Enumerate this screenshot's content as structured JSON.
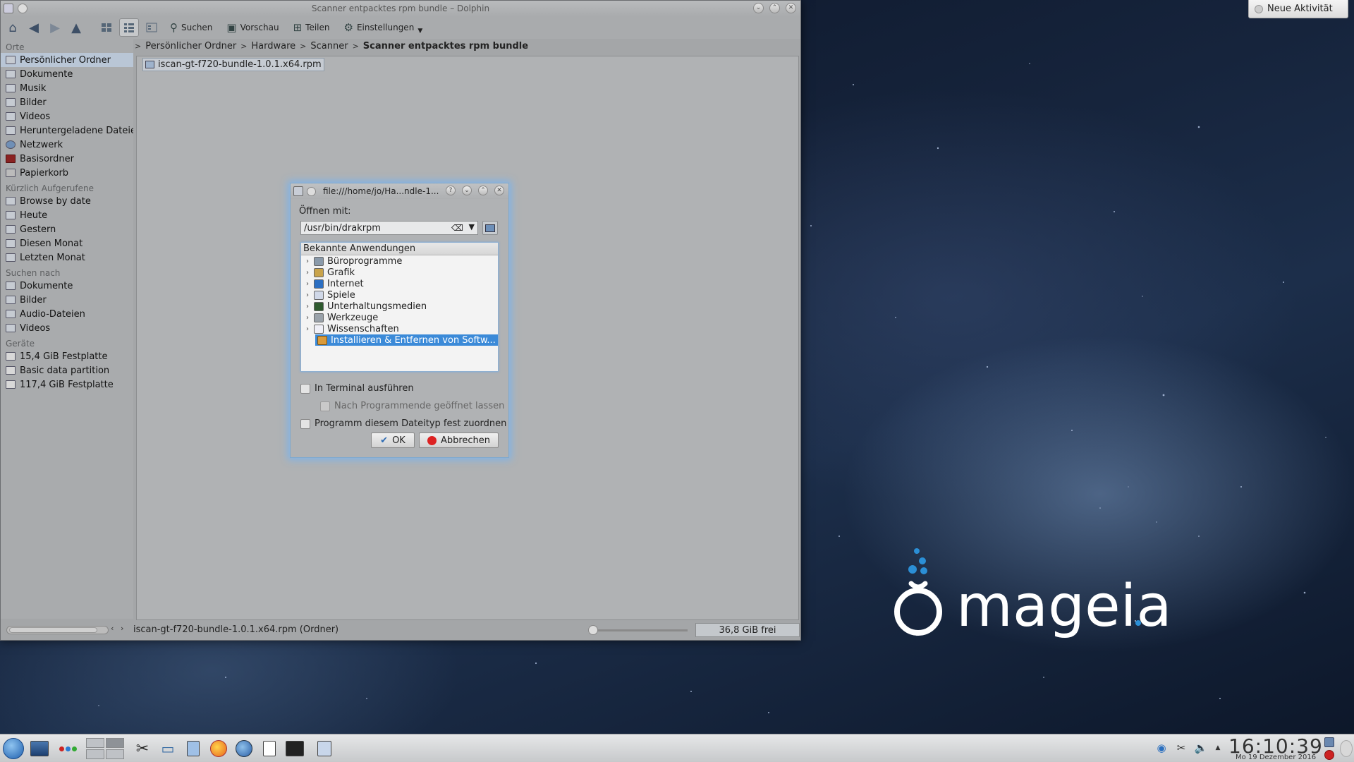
{
  "desktop": {
    "activity_button": "Neue Aktivität",
    "logo_text": "mageia"
  },
  "dolphin": {
    "title": "Scanner entpacktes rpm bundle – Dolphin",
    "toolbar": {
      "search": "Suchen",
      "preview": "Vorschau",
      "share": "Teilen",
      "settings": "Einstellungen"
    },
    "places": {
      "sections": [
        {
          "title": "Orte",
          "items": [
            {
              "label": "Persönlicher Ordner",
              "icon": "home-folder-icon",
              "selected": true
            },
            {
              "label": "Dokumente",
              "icon": "folder-icon"
            },
            {
              "label": "Musik",
              "icon": "folder-icon"
            },
            {
              "label": "Bilder",
              "icon": "folder-icon"
            },
            {
              "label": "Videos",
              "icon": "folder-icon"
            },
            {
              "label": "Heruntergeladene Dateien",
              "icon": "folder-icon"
            },
            {
              "label": "Netzwerk",
              "icon": "network-icon"
            },
            {
              "label": "Basisordner",
              "icon": "root-folder-icon"
            },
            {
              "label": "Papierkorb",
              "icon": "trash-icon"
            }
          ]
        },
        {
          "title": "Kürzlich Aufgerufene",
          "items": [
            {
              "label": "Browse by date",
              "icon": "calendar-icon"
            },
            {
              "label": "Heute",
              "icon": "calendar-icon"
            },
            {
              "label": "Gestern",
              "icon": "calendar-icon"
            },
            {
              "label": "Diesen Monat",
              "icon": "calendar-icon"
            },
            {
              "label": "Letzten Monat",
              "icon": "calendar-icon"
            }
          ]
        },
        {
          "title": "Suchen nach",
          "items": [
            {
              "label": "Dokumente",
              "icon": "document-search-icon"
            },
            {
              "label": "Bilder",
              "icon": "image-search-icon"
            },
            {
              "label": "Audio-Dateien",
              "icon": "audio-search-icon"
            },
            {
              "label": "Videos",
              "icon": "video-search-icon"
            }
          ]
        },
        {
          "title": "Geräte",
          "items": [
            {
              "label": "15,4 GiB Festplatte",
              "icon": "disk-icon"
            },
            {
              "label": "Basic data partition",
              "icon": "disk-icon"
            },
            {
              "label": "117,4 GiB Festplatte",
              "icon": "disk-icon"
            }
          ]
        }
      ]
    },
    "breadcrumb": [
      "Persönlicher Ordner",
      "Hardware",
      "Scanner",
      "Scanner entpacktes rpm bundle"
    ],
    "files": [
      {
        "name": "iscan-gt-f720-bundle-1.0.1.x64.rpm"
      }
    ],
    "status": {
      "text": "iscan-gt-f720-bundle-1.0.1.x64.rpm (Ordner)",
      "free": "36,8 GiB frei"
    }
  },
  "dialog": {
    "title": "file:///home/jo/Ha...ndle-1...",
    "open_with_label": "Öffnen mit:",
    "command_value": "/usr/bin/drakrpm",
    "tree_header": "Bekannte Anwendungen",
    "categories": [
      {
        "label": "Büroprogramme",
        "icon": "office-icon"
      },
      {
        "label": "Grafik",
        "icon": "graphics-icon"
      },
      {
        "label": "Internet",
        "icon": "internet-icon"
      },
      {
        "label": "Spiele",
        "icon": "games-icon"
      },
      {
        "label": "Unterhaltungsmedien",
        "icon": "multimedia-icon"
      },
      {
        "label": "Werkzeuge",
        "icon": "tools-icon"
      },
      {
        "label": "Wissenschaften",
        "icon": "science-icon"
      }
    ],
    "selected_app": "Installieren & Entfernen von Softw...",
    "checkbox_terminal": "In Terminal ausführen",
    "checkbox_keep_open": "Nach Programmende geöffnet lassen",
    "checkbox_remember": "Programm diesem Dateityp fest zuordnen",
    "ok": "OK",
    "cancel": "Abbrechen"
  },
  "taskbar": {
    "clock": "16:10:39",
    "date": "Mo 19 Dezember 2016"
  }
}
